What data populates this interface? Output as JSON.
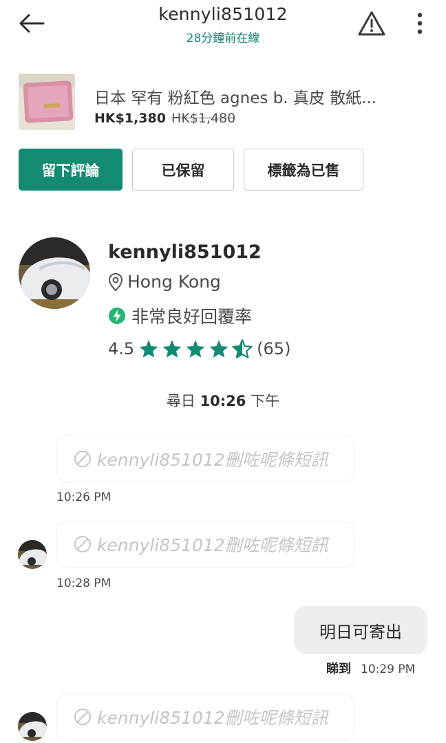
{
  "header": {
    "title": "kennyli851012",
    "subtitle": "28分鐘前在線"
  },
  "product": {
    "name": "日本 罕有 粉紅色 agnes b. 真皮 散紙...",
    "price": "HK$1,380",
    "original_price": "HK$1,480"
  },
  "actions": {
    "review": "留下評論",
    "reserved": "已保留",
    "mark_sold": "標籤為已售"
  },
  "profile": {
    "username": "kennyli851012",
    "location": "Hong Kong",
    "response": "非常良好回覆率",
    "rating": "4.5",
    "rating_stars": 4.5,
    "review_count": "(65)"
  },
  "date_separator": {
    "day": "尋日",
    "time": "10:26",
    "period": "下午"
  },
  "messages": [
    {
      "type": "deleted",
      "text": "kennyli851012刪咗呢條短訊",
      "time": "10:26 PM"
    },
    {
      "type": "deleted",
      "text": "kennyli851012刪咗呢條短訊",
      "time": "10:28 PM"
    },
    {
      "type": "outgoing",
      "text": "明日可寄出",
      "status": "睇到",
      "time": "10:29 PM"
    },
    {
      "type": "deleted",
      "text": "kennyli851012刪咗呢條短訊",
      "time": ""
    }
  ],
  "colors": {
    "accent": "#138a72",
    "bolt": "#22b573",
    "deleted_text": "#c4c4c4",
    "bubble_bg": "#eeeeee"
  },
  "icons": {
    "back": "back-arrow-icon",
    "report": "warning-icon",
    "more": "more-vertical-icon",
    "location": "location-pin-icon",
    "response": "lightning-bolt-icon",
    "star": "star-icon",
    "deleted": "prohibited-icon"
  }
}
